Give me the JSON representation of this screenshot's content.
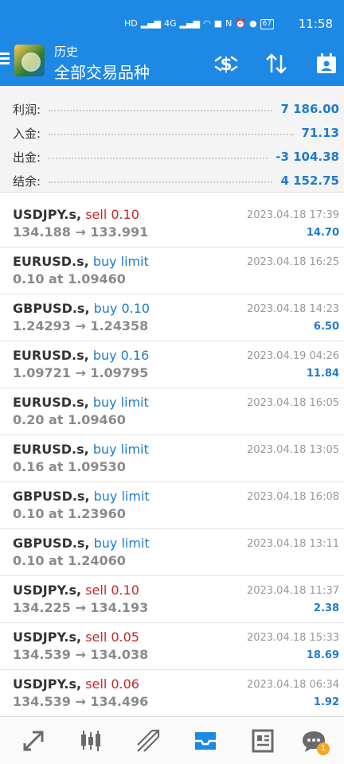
{
  "status_bar": {
    "time": "11:58",
    "battery": "67",
    "network_labels": [
      "HD",
      "HD",
      "4G",
      "4G"
    ]
  },
  "header": {
    "subtitle": "历史",
    "title": "全部交易品种",
    "icons": [
      "menu-icon",
      "app-logo",
      "currency-icon",
      "sort-icon",
      "calendar-icon"
    ]
  },
  "summary": [
    {
      "label": "利润:",
      "value": "7 186.00"
    },
    {
      "label": "入金:",
      "value": "71.13"
    },
    {
      "label": "出金:",
      "value": "-3 104.38"
    },
    {
      "label": "结余:",
      "value": "4 152.75"
    }
  ],
  "orders": [
    {
      "symbol": "USDJPY.s,",
      "type": "sell 0.10",
      "side": "sell",
      "prices": "134.188 → 133.991",
      "time": "2023.04.18 17:39",
      "profit": "14.70"
    },
    {
      "symbol": "EURUSD.s,",
      "type": "buy limit",
      "side": "buy",
      "prices": "0.10 at 1.09460",
      "time": "2023.04.18 16:25",
      "profit": ""
    },
    {
      "symbol": "GBPUSD.s,",
      "type": "buy 0.10",
      "side": "buy",
      "prices": "1.24293 → 1.24358",
      "time": "2023.04.18 14:23",
      "profit": "6.50"
    },
    {
      "symbol": "EURUSD.s,",
      "type": "buy 0.16",
      "side": "buy",
      "prices": "1.09721 → 1.09795",
      "time": "2023.04.19 04:26",
      "profit": "11.84"
    },
    {
      "symbol": "EURUSD.s,",
      "type": "buy limit",
      "side": "buy",
      "prices": "0.20 at 1.09460",
      "time": "2023.04.18 16:05",
      "profit": ""
    },
    {
      "symbol": "EURUSD.s,",
      "type": "buy limit",
      "side": "buy",
      "prices": "0.16 at 1.09530",
      "time": "2023.04.18 13:05",
      "profit": ""
    },
    {
      "symbol": "GBPUSD.s,",
      "type": "buy limit",
      "side": "buy",
      "prices": "0.10 at 1.23960",
      "time": "2023.04.18 16:08",
      "profit": ""
    },
    {
      "symbol": "GBPUSD.s,",
      "type": "buy limit",
      "side": "buy",
      "prices": "0.10 at 1.24060",
      "time": "2023.04.18 13:11",
      "profit": ""
    },
    {
      "symbol": "USDJPY.s,",
      "type": "sell 0.10",
      "side": "sell",
      "prices": "134.225 → 134.193",
      "time": "2023.04.18 11:37",
      "profit": "2.38"
    },
    {
      "symbol": "USDJPY.s,",
      "type": "sell 0.05",
      "side": "sell",
      "prices": "134.539 → 134.038",
      "time": "2023.04.18 15:33",
      "profit": "18.69"
    },
    {
      "symbol": "USDJPY.s,",
      "type": "sell 0.06",
      "side": "sell",
      "prices": "134.539 → 134.496",
      "time": "2023.04.18 06:34",
      "profit": "1.92"
    }
  ],
  "bottom_nav": {
    "items": [
      "quotes-icon",
      "chart-icon",
      "trade-icon",
      "history-icon",
      "news-icon",
      "messages-icon"
    ],
    "active": "history-icon",
    "messages_badge": "1"
  },
  "colors": {
    "primary": "#1e88e5",
    "sell": "#c62828",
    "buy": "#1f7ad1",
    "muted": "#8a8a8a"
  }
}
